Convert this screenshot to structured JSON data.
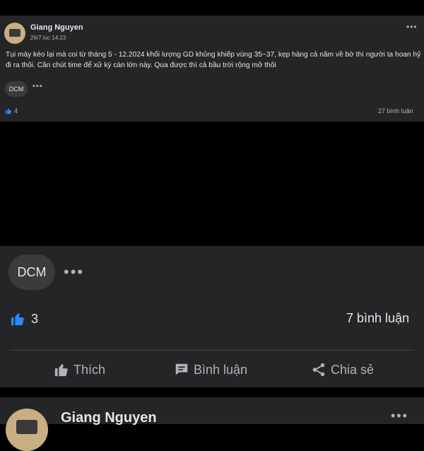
{
  "post1": {
    "author": "Giang Nguyen",
    "time": "26/7 lúc 14:23",
    "more": "•••",
    "text": "Tụi mày kéo lại mà coi từ tháng 5 - 12.2024 khối lượng GD khủng khiếp vùng 35~37, kẹp hàng cả năm về bờ thì người ta hoan hỷ đi ra thôi. Cần chút time để xử kỳ càn lớn này. Qua được thì cả bầu trời rộng mở thôi",
    "reaction_chip": "DCM",
    "reaction_more": "•••",
    "likes": "4",
    "comments": "27 bình luận"
  },
  "zoom": {
    "reaction_chip": "DCM",
    "reaction_more": "•••",
    "likes": "3",
    "comments": "7 bình luận",
    "actions": {
      "like": "Thích",
      "comment": "Bình luận",
      "share": "Chia sẻ"
    }
  },
  "post2": {
    "author": "Giang Nguyen",
    "more": "•••"
  },
  "colors": {
    "card_bg": "#242526",
    "like_blue": "#2d88ff",
    "text_primary": "#e4e6eb",
    "text_secondary": "#b0b3b8"
  },
  "icons": [
    "thumbs-up-icon",
    "comment-icon",
    "share-icon",
    "more-icon",
    "avatar"
  ]
}
